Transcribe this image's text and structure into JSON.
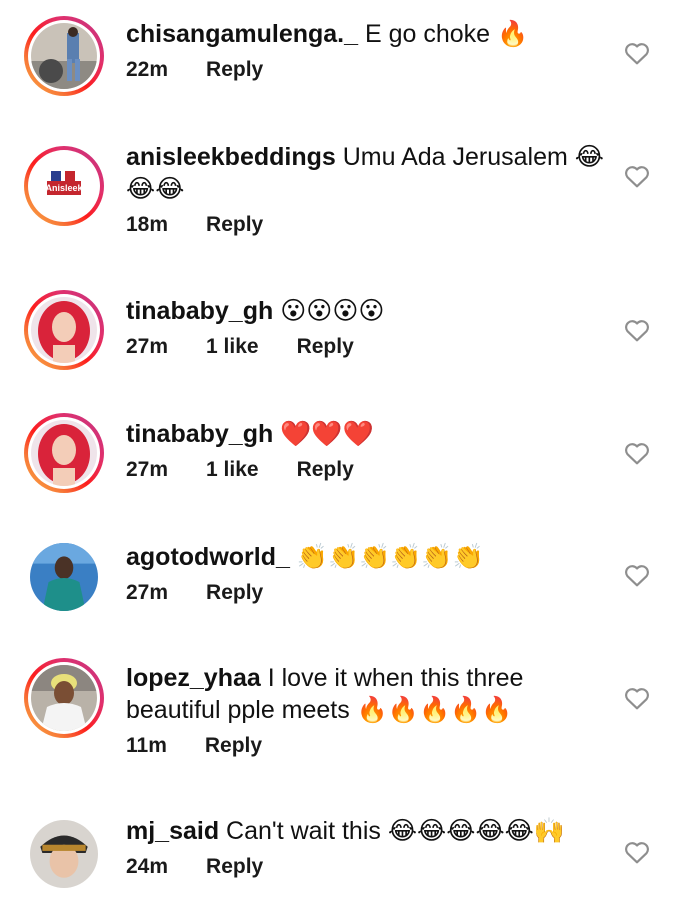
{
  "comments": [
    {
      "username": "chisangamulenga._",
      "text": " E go choke 🔥",
      "time": "22m",
      "likes": "",
      "reply": "Reply"
    },
    {
      "username": "anisleekbeddings",
      "text": " Umu Ada Jerusalem 😂😂😂",
      "time": "18m",
      "likes": "",
      "reply": "Reply",
      "avatar_logo": "Anisleek"
    },
    {
      "username": "tinababy_gh",
      "text": " 😮😮😮😮",
      "time": "27m",
      "likes": "1 like",
      "reply": "Reply"
    },
    {
      "username": "tinababy_gh",
      "text": " ❤️❤️❤️",
      "time": "27m",
      "likes": "1 like",
      "reply": "Reply"
    },
    {
      "username": "agotodworld_",
      "text": " 👏👏👏👏👏👏",
      "time": "27m",
      "likes": "",
      "reply": "Reply"
    },
    {
      "username": "lopez_yhaa",
      "text": " I love it when this three beautiful pple meets 🔥🔥🔥🔥🔥",
      "time": "11m",
      "likes": "",
      "reply": "Reply"
    },
    {
      "username": "mj_said",
      "text": " Can't wait this 😂😂😂😂😂🙌",
      "time": "24m",
      "likes": "",
      "reply": "Reply"
    }
  ],
  "icons": {
    "like": "heart-outline-icon"
  },
  "colors": {
    "ring_start": "#fcaf45",
    "ring_end": "#c13584",
    "heart_stroke": "#8e8e8e"
  }
}
